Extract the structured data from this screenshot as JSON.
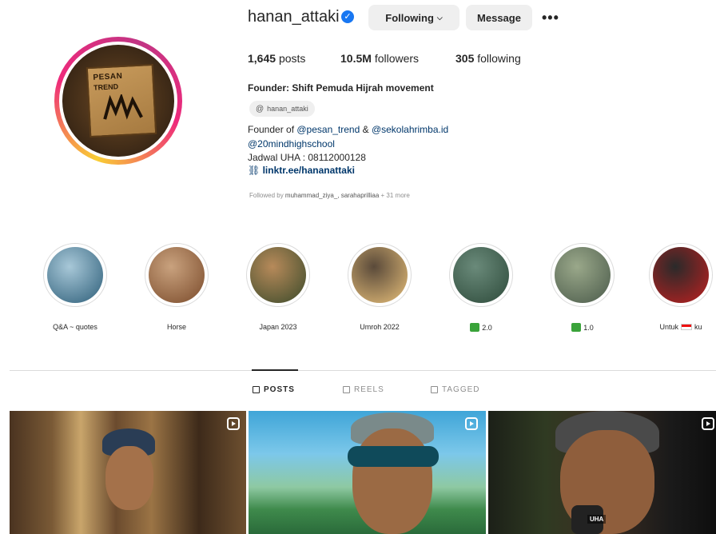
{
  "profile": {
    "username": "hanan_attaki",
    "verified_icon": "verified-badge-icon",
    "following_label": "Following",
    "message_label": "Message",
    "more_label": "•••",
    "avatar_text_1": "PESAN",
    "avatar_text_2": "TREND"
  },
  "stats": {
    "posts_count": "1,645",
    "posts_label": "posts",
    "followers_count": "10.5M",
    "followers_label": "followers",
    "following_count": "305",
    "following_label": "following"
  },
  "bio": {
    "name": "Founder: Shift Pemuda Hijrah movement",
    "threads_handle": "hanan_attaki",
    "line1_prefix": "Founder of ",
    "line1_mention1": "@pesan_trend",
    "line1_mid": " & ",
    "line1_mention2": "@sekolahrimba.id",
    "line2": "@20mindhighschool",
    "line3": "Jadwal UHA : 08112000128",
    "link": "linktr.ee/hananattaki",
    "followed_by_prefix": "Followed by ",
    "followed_by_names": "muhammad_ziya_, sarahaprilliaa",
    "followed_by_suffix": " + 31 more"
  },
  "highlights": [
    {
      "label": "Q&A ~ quotes",
      "colors": [
        "#2c5d78",
        "#a8c8d8"
      ]
    },
    {
      "label": "Horse",
      "colors": [
        "#7a4a2a",
        "#c9a27e"
      ]
    },
    {
      "label": "Japan 2023",
      "colors": [
        "#3a4a2a",
        "#b78a5a"
      ]
    },
    {
      "label": "Umroh 2022",
      "colors": [
        "#e8c07a",
        "#5a4a3a"
      ]
    },
    {
      "label": "2.0",
      "colors": [
        "#2d4a3a",
        "#6a8a7a"
      ]
    },
    {
      "label": "1.0",
      "colors": [
        "#4a5a4a",
        "#9aa88a"
      ]
    },
    {
      "label": "Untuk",
      "label_suffix": "ku",
      "colors": [
        "#c02020",
        "#2a2a2a"
      ]
    }
  ],
  "tabs": {
    "posts": "POSTS",
    "reels": "REELS",
    "tagged": "TAGGED"
  },
  "posts": {
    "watermark": "UHA"
  }
}
